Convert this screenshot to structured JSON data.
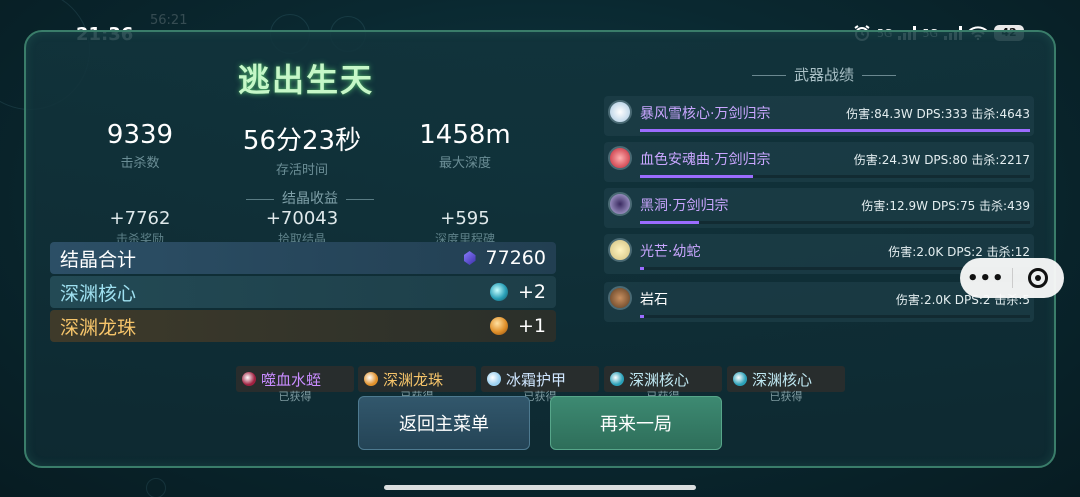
{
  "status": {
    "time": "21:36",
    "ghost_time": "56:21",
    "network_1": "5G",
    "network_2": "5G",
    "battery": "42",
    "icons": [
      "alarm-icon",
      "signal-icon",
      "signal-icon",
      "wifi-icon",
      "battery-icon"
    ]
  },
  "title": "逃出生天",
  "stats": [
    {
      "value": "9339",
      "label": "击杀数"
    },
    {
      "value": "56分23秒",
      "label": "存活时间"
    },
    {
      "value": "1458m",
      "label": "最大深度"
    }
  ],
  "crystal_section": {
    "heading": "结晶收益",
    "gains": [
      {
        "value": "+7762",
        "label": "击杀奖励"
      },
      {
        "value": "+70043",
        "label": "拾取结晶"
      },
      {
        "value": "+595",
        "label": "深度里程碑"
      }
    ]
  },
  "summary": {
    "total_label": "结晶合计",
    "total_value": "77260",
    "core_label": "深渊核心",
    "core_value": "+2",
    "pearl_label": "深渊龙珠",
    "pearl_value": "+1"
  },
  "weapons_heading": "武器战绩",
  "weapons": [
    {
      "name": "暴风雪核心·万剑归宗",
      "stats": "伤害:84.3W DPS:333 击杀:4643",
      "share": 1.0,
      "color": "#c9a6ff"
    },
    {
      "name": "血色安魂曲·万剑归宗",
      "stats": "伤害:24.3W DPS:80 击杀:2217",
      "share": 0.29,
      "color": "#c9a6ff"
    },
    {
      "name": "黑洞·万剑归宗",
      "stats": "伤害:12.9W DPS:75 击杀:439",
      "share": 0.15,
      "color": "#c9a6ff"
    },
    {
      "name": "光芒·幼蛇",
      "stats": "伤害:2.0K DPS:2 击杀:12",
      "share": 0.01,
      "color": "#c9a6ff"
    },
    {
      "name": "岩石",
      "stats": "伤害:2.0K DPS:2 击杀:5",
      "share": 0.01,
      "color": "#ffffff"
    }
  ],
  "loot": [
    {
      "name": "噬血水蛭",
      "status": "已获得",
      "color": "#c98cff",
      "dot": "#a02040"
    },
    {
      "name": "深渊龙珠",
      "status": "已获得",
      "color": "#f5c46a",
      "dot": "#e0902a"
    },
    {
      "name": "冰霜护甲",
      "status": "已获得",
      "color": "#cfe6ff",
      "dot": "#9ad0f0"
    },
    {
      "name": "深渊核心",
      "status": "已获得",
      "color": "#bfe8f2",
      "dot": "#2aa0b8"
    },
    {
      "name": "深渊核心",
      "status": "已获得",
      "color": "#bfe8f2",
      "dot": "#2aa0b8"
    }
  ],
  "buttons": {
    "main_menu": "返回主菜单",
    "play_again": "再来一局"
  },
  "capsule": {
    "more": "•••"
  }
}
